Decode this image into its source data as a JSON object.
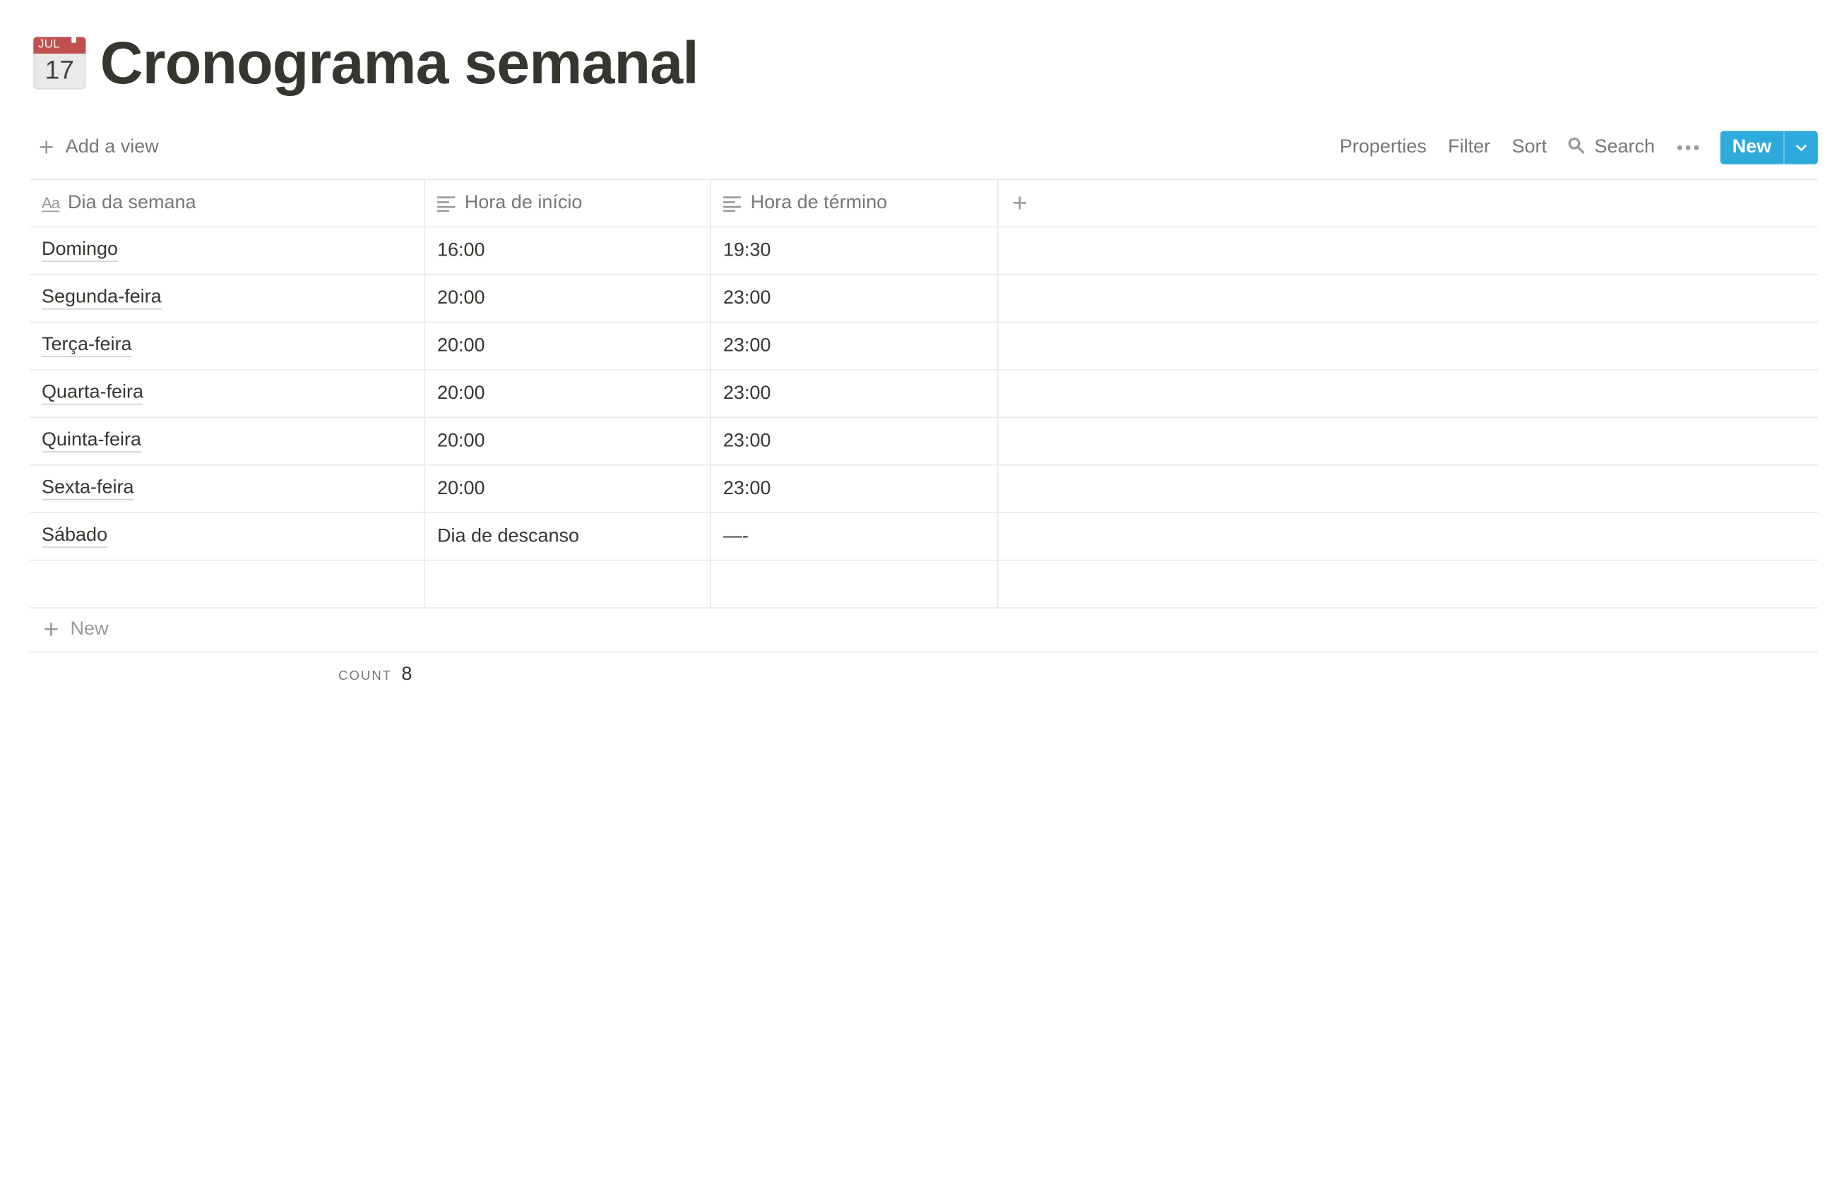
{
  "page": {
    "icon": "calendar-icon",
    "icon_month": "JUL",
    "icon_day": "17",
    "title": "Cronograma semanal"
  },
  "toolbar": {
    "add_view": "Add a view",
    "properties": "Properties",
    "filter": "Filter",
    "sort": "Sort",
    "search": "Search",
    "new": "New"
  },
  "table": {
    "columns": [
      {
        "label": "Dia da semana",
        "icon": "title-aa-icon"
      },
      {
        "label": "Hora de início",
        "icon": "text-lines-icon"
      },
      {
        "label": "Hora de término",
        "icon": "text-lines-icon"
      }
    ],
    "rows": [
      {
        "day": "Domingo",
        "start": "16:00",
        "end": "19:30"
      },
      {
        "day": "Segunda-feira",
        "start": "20:00",
        "end": "23:00"
      },
      {
        "day": "Terça-feira",
        "start": "20:00",
        "end": "23:00"
      },
      {
        "day": "Quarta-feira",
        "start": "20:00",
        "end": "23:00"
      },
      {
        "day": "Quinta-feira",
        "start": "20:00",
        "end": "23:00"
      },
      {
        "day": "Sexta-feira",
        "start": "20:00",
        "end": "23:00"
      },
      {
        "day": "Sábado",
        "start": "Dia de descanso",
        "end": "—-"
      },
      {
        "day": "",
        "start": "",
        "end": ""
      }
    ],
    "new_row_label": "New",
    "count_label": "COUNT",
    "count_value": "8"
  },
  "colors": {
    "accent": "#2eaadc",
    "text": "#37352f",
    "muted": "#787774",
    "border": "#e9e9e7"
  }
}
